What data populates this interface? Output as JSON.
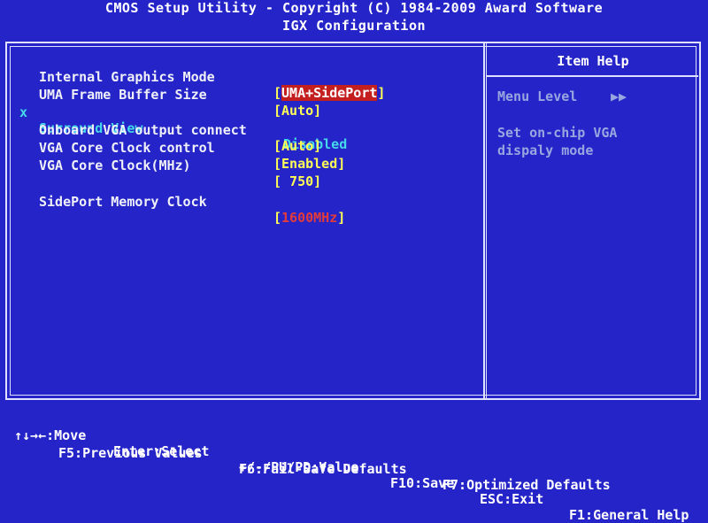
{
  "header": {
    "title": "CMOS Setup Utility - Copyright (C) 1984-2009 Award Software",
    "subtitle": "IGX Configuration"
  },
  "settings": [
    {
      "label": "Internal Graphics Mode",
      "value": "UMA+SidePort",
      "state": "selected"
    },
    {
      "label": "UMA Frame Buffer Size",
      "value": "Auto",
      "state": "normal"
    },
    {
      "label": "Surround View",
      "value": "Disabled",
      "state": "disabled",
      "mark": "x"
    },
    {
      "label": "Onboard VGA output connect",
      "value": "Auto",
      "state": "normal"
    },
    {
      "label": "VGA Core Clock control",
      "value": "Enabled",
      "state": "normal"
    },
    {
      "label": "VGA Core Clock(MHz)",
      "value": " 750",
      "state": "normal"
    },
    {
      "label": "SidePort Memory Clock",
      "value": "1600MHz",
      "state": "red"
    }
  ],
  "help": {
    "title": "Item Help",
    "menu_level_label": "Menu Level",
    "menu_level_arrows": "▶▶",
    "description_line1": "Set on-chip VGA",
    "description_line2": "dispaly mode"
  },
  "footer": {
    "move": "↑↓→←:Move",
    "select": "Enter:Select",
    "value": "+/-/PU/PD:Value",
    "save": "F10:Save",
    "exit": "ESC:Exit",
    "general_help": "F1:General Help",
    "previous_values": "F5:Previous Values",
    "failsafe": "F6:Fail-Safe Defaults",
    "optimized": "F7:Optimized Defaults"
  },
  "colors": {
    "background": "#2424c8",
    "selected_bg": "#c41f1f",
    "bracket": "#ffff55",
    "disabled": "#44d8e8"
  }
}
